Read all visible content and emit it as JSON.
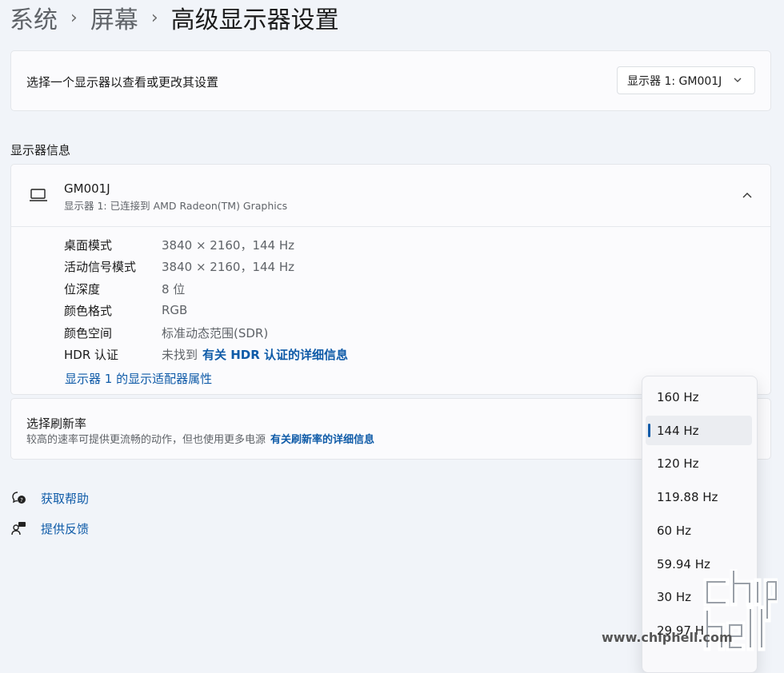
{
  "breadcrumb": {
    "items": [
      "系统",
      "屏幕"
    ],
    "current": "高级显示器设置",
    "separator": "›"
  },
  "monitor_select": {
    "label": "选择一个显示器以查看或更改其设置",
    "value": "显示器 1: GM001J"
  },
  "display_info": {
    "section_title": "显示器信息",
    "name": "GM001J",
    "subtitle": "显示器 1: 已连接到 AMD Radeon(TM) Graphics",
    "rows": [
      {
        "label": "桌面模式",
        "value": "3840 × 2160，144 Hz"
      },
      {
        "label": "活动信号模式",
        "value": "3840 × 2160，144 Hz"
      },
      {
        "label": "位深度",
        "value": "8 位"
      },
      {
        "label": "颜色格式",
        "value": "RGB"
      },
      {
        "label": "颜色空间",
        "value": "标准动态范围(SDR)"
      },
      {
        "label": "HDR 认证",
        "value": "未找到",
        "link": "有关 HDR 认证的详细信息"
      }
    ],
    "adapter_link": "显示器 1 的显示适配器属性"
  },
  "refresh_rate": {
    "title": "选择刷新率",
    "description": "较高的速率可提供更流畅的动作，但也使用更多电源",
    "link": "有关刷新率的详细信息",
    "options": [
      "160 Hz",
      "144 Hz",
      "120 Hz",
      "119.88 Hz",
      "60 Hz",
      "59.94 Hz",
      "30 Hz",
      "29.97 Hz"
    ],
    "selected": "144 Hz"
  },
  "help": {
    "get_help": "获取帮助",
    "feedback": "提供反馈"
  },
  "watermark": {
    "url": "www.chiphell.com",
    "logo_text": "chip hell"
  },
  "colors": {
    "accent": "#0f5ba8",
    "background": "#f1f4f9",
    "card": "#fbfbfd"
  },
  "icons": {
    "monitor": "laptop-icon",
    "collapse": "chevron-up-icon",
    "dropdown": "chevron-down-icon",
    "help": "help-chat-icon",
    "feedback": "feedback-person-icon"
  }
}
